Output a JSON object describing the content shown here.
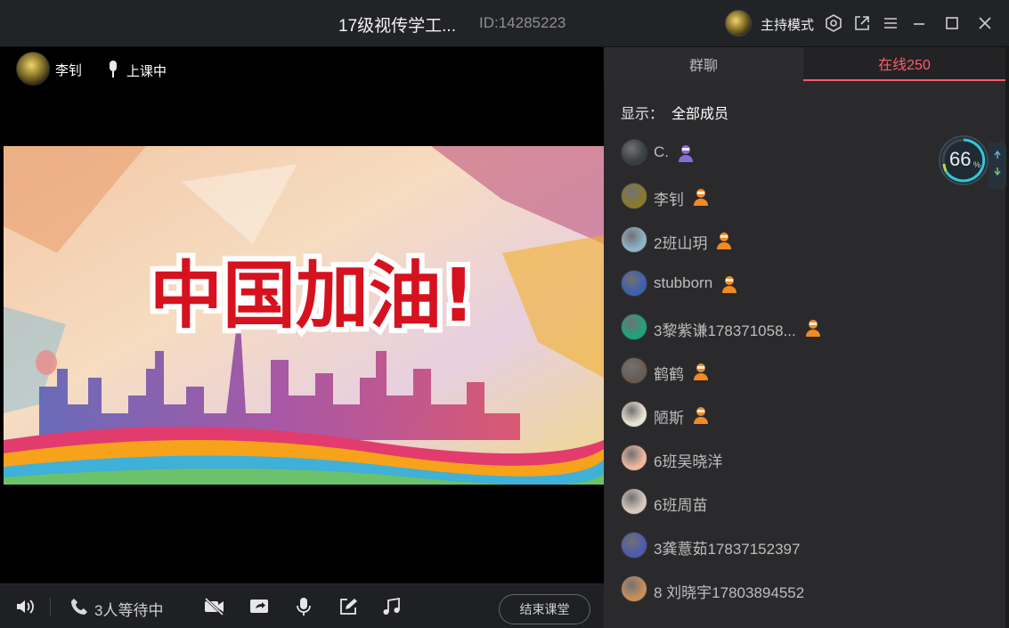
{
  "window": {
    "title": "17级视传学工...",
    "room_id": "ID:14285223",
    "host_mode": "主持模式",
    "icons": [
      "settings-hex-icon",
      "popout-icon",
      "menu-icon",
      "minimize-icon",
      "maximize-icon",
      "close-icon"
    ]
  },
  "stage": {
    "teacher_name": "李钊",
    "status": "上课中"
  },
  "bottom_bar": {
    "waiting": "3人等待中",
    "end_class": "结束课堂",
    "icons": [
      "speaker-icon",
      "phone-icon",
      "camera-off-icon",
      "screen-share-icon",
      "microphone-icon",
      "edit-icon",
      "music-icon"
    ]
  },
  "sidebar": {
    "tabs": [
      {
        "label": "群聊",
        "active": false
      },
      {
        "label": "在线250",
        "active": true
      }
    ],
    "filter_label": "显示：",
    "filter_value": "全部成员",
    "members": [
      {
        "name": "C.",
        "avatar_color": "#3a3f44",
        "role": "purple"
      },
      {
        "name": "李钊",
        "avatar_color": "#8a7a2c",
        "role": "orange"
      },
      {
        "name": "2班山玥",
        "avatar_color": "#8fb3c7",
        "role": "orange"
      },
      {
        "name": "stubborn",
        "avatar_color": "#3f5fb0",
        "role": "orange"
      },
      {
        "name": "3黎紫谦178371058...",
        "avatar_color": "#1fa37a",
        "role": "orange"
      },
      {
        "name": "鹤鹤",
        "avatar_color": "#6a5b52",
        "role": "orange"
      },
      {
        "name": "陋斯",
        "avatar_color": "#e9e3d2",
        "role": "orange"
      },
      {
        "name": "6班吴晓洋",
        "avatar_color": "#f0b8a0",
        "role": ""
      },
      {
        "name": "6班周苗",
        "avatar_color": "#d9c7bc",
        "role": ""
      },
      {
        "name": "3龚薏茹17837152397",
        "avatar_color": "#4b5bb0",
        "role": ""
      },
      {
        "name": "8 刘晓宇17803894552",
        "avatar_color": "#c98e5a",
        "role": ""
      }
    ]
  },
  "perf_widget": {
    "value": "66",
    "unit": "%"
  },
  "colors": {
    "accent": "#ff5b6b",
    "role_orange": "#f08a24",
    "role_purple": "#8c6bd8"
  }
}
